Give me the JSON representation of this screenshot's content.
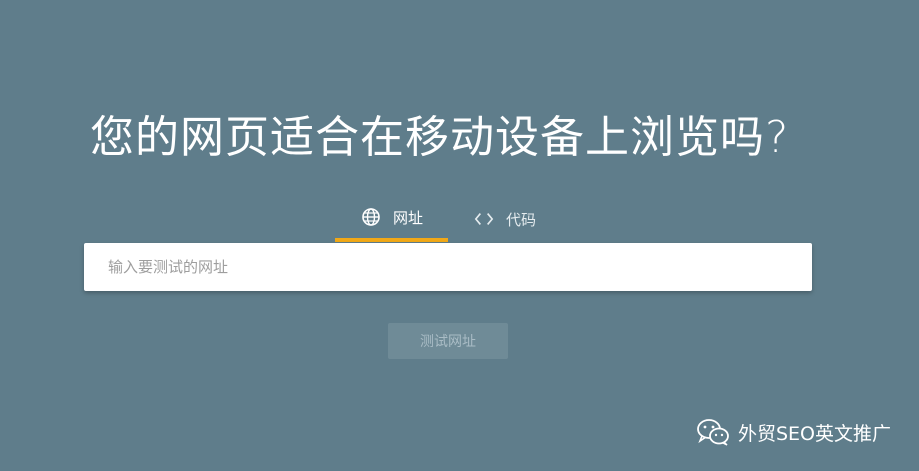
{
  "page": {
    "headline": "您的网页适合在移动设备上浏览吗?",
    "background_color": "#5f7d8b"
  },
  "tabs": [
    {
      "label": "网址",
      "icon": "globe-icon",
      "active": true
    },
    {
      "label": "代码",
      "icon": "code-brackets-icon",
      "active": false
    }
  ],
  "search": {
    "value": "",
    "placeholder": "输入要测试的网址"
  },
  "actions": {
    "test_button_label": "测试网址"
  },
  "watermark": {
    "text": "外贸SEO英文推广",
    "icon": "wechat-icon"
  },
  "colors": {
    "accent": "#f1a817",
    "button_bg": "#6f8b97",
    "button_text": "#a9bcc5"
  }
}
